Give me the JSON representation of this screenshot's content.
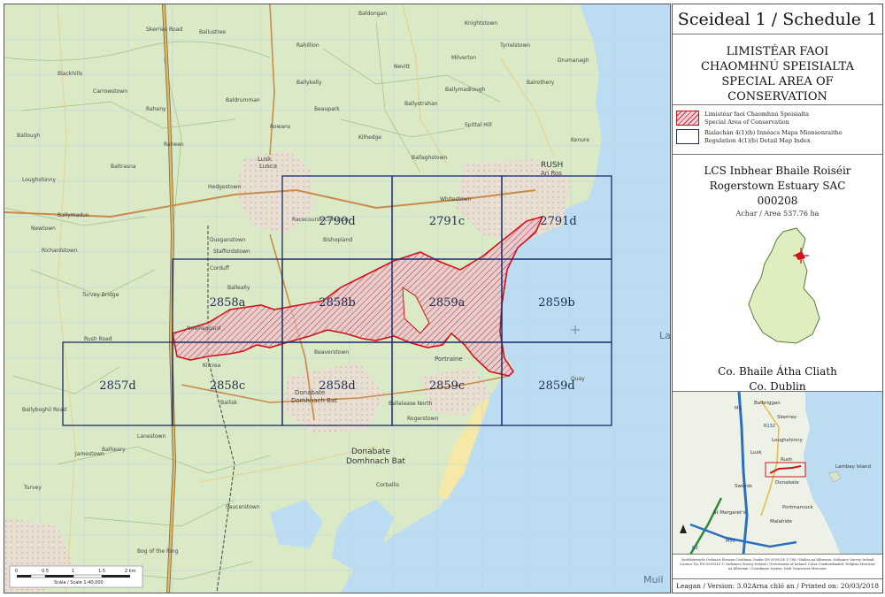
{
  "title": "Sceideal 1 / Schedule 1",
  "heading": {
    "line1": "LIMISTÉAR FAOI",
    "line2": "CHAOMHNÚ SPEISIALTA",
    "line3": "SPECIAL AREA OF CONSERVATION"
  },
  "legend": {
    "sac_irish": "Limistéar faoi Chaomhnú Speisialta",
    "sac_english": "Special Area of Conservation",
    "index_irish": "Rialachán 4(1)(b) Innéacs Mapa Mionsonraithe",
    "index_english": "Regulation 4(1)(b) Detail Map Index"
  },
  "site": {
    "name_irish": "LCS Inbhear Bhaile Roiséir",
    "name_english": "Rogerstown Estuary SAC",
    "code": "000208",
    "area": "Achar / Area 537.76 ha",
    "county_irish": "Co. Bhaile Átha Cliath",
    "county_english": "Co. Dublin"
  },
  "map_tiles": [
    "2790d",
    "2791c",
    "2791d",
    "2858a",
    "2858b",
    "2859a",
    "2859b",
    "2857d",
    "2858c",
    "2858d",
    "2859c",
    "2859d"
  ],
  "map_places": {
    "lusk": "Lusk",
    "lusk_irish": "Lusca",
    "rush": "RUSH",
    "rush_irish": "An Ros",
    "donabate": "Donabate",
    "donabate_irish": "Domhnach Bat",
    "donabate2": "Donabate",
    "donabate2_irish": "Domhnach Bat",
    "portraine": "Portraine",
    "sea_partial": "La",
    "mul_partial": "Muil",
    "small": [
      "Baldongan",
      "Ballough",
      "Ballykelly",
      "Ballystrahan",
      "Ballymadrough",
      "Corduff",
      "Newhaggard",
      "Turvey",
      "Beaverstown",
      "Lanestown",
      "Balheary",
      "Corballis",
      "Whitestown",
      "Kenure",
      "Drumanagh",
      "Rogerstown",
      "Hedgestown",
      "Newtown",
      "Raheny",
      "Jamestown",
      "Ballymadun",
      "Ballisk",
      "Racecourse Common",
      "Bishopland",
      "Dusganstown",
      "Richardstown",
      "Staffordstown",
      "Balleally",
      "Ballalease North",
      "Quay",
      "Skerries Road",
      "Rahillion",
      "Kilcrea",
      "Turvey Bridge",
      "Spittal Hill",
      "Blackhills",
      "Beaupark",
      "Nevitt",
      "Tyrrelstown",
      "Knightstown",
      "Ballustree",
      "Balrothery",
      "Loughshinny",
      "Baltrasna",
      "Ballaghstown",
      "Rowans",
      "Carrowstown",
      "Saucerstown",
      "Rush Road",
      "Ballyboghil Road",
      "Bog of the Ring",
      "Kilhedge",
      "Baldrumman",
      "Raheen",
      "Milverton"
    ]
  },
  "scale": {
    "ticks": [
      "0",
      "0.5",
      "1",
      "1.5",
      "2 km"
    ],
    "label": "Scála / Scale 1:40,000"
  },
  "inset": {
    "places": [
      "Balbriggan",
      "Skerries",
      "Loughshinny",
      "Rush",
      "Lambay Island",
      "Donabate",
      "Portmarnock",
      "Malahide",
      "Swords",
      "Lusk",
      "St Margaret's"
    ],
    "roads": [
      "M1",
      "N2",
      "M50",
      "R132"
    ]
  },
  "credits": "Suirbhéireacht Ordanáis Éireann Ceadúnas Uimhir EN 0059216 © OSi / Rialtas na hÉireann. Ordnance Survey Ireland Licence No. EN 0059216 © Ordnance Survey Ireland / Government of Ireland. Córas Comhordanáidí: Teilgean Mercator na hÉireann / Coordinate System: Irish Transverse Mercator",
  "version": "Leagan / Version: 3.02",
  "printed": "Arna chló an / Printed on: 20/03/2018",
  "colors": {
    "land": "#d9e9c4",
    "sea": "#bcdcf2",
    "grid": "#1c2c6a",
    "sac": "#c0141c",
    "sac_fill": "#e8b4c0"
  }
}
